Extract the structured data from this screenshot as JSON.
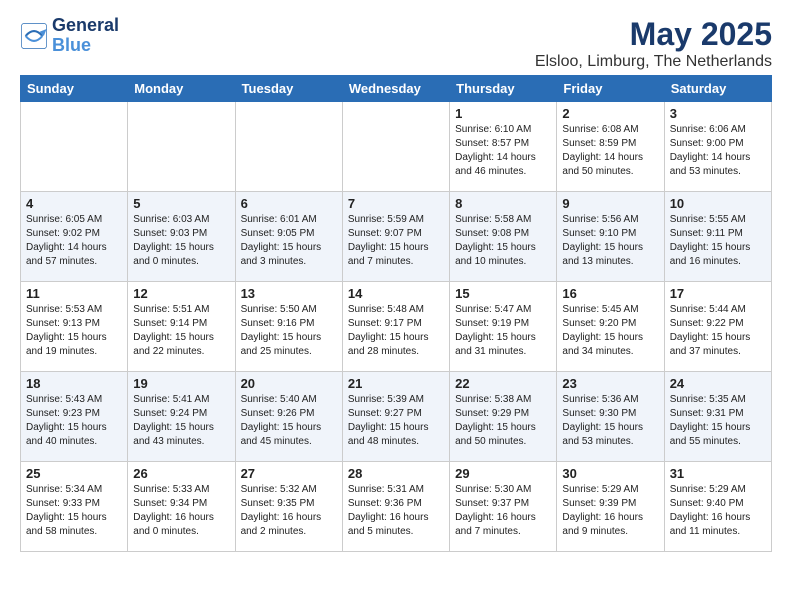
{
  "logo": {
    "line1": "General",
    "line2": "Blue"
  },
  "title": "May 2025",
  "location": "Elsloo, Limburg, The Netherlands",
  "days_of_week": [
    "Sunday",
    "Monday",
    "Tuesday",
    "Wednesday",
    "Thursday",
    "Friday",
    "Saturday"
  ],
  "weeks": [
    [
      {
        "day": "",
        "info": ""
      },
      {
        "day": "",
        "info": ""
      },
      {
        "day": "",
        "info": ""
      },
      {
        "day": "",
        "info": ""
      },
      {
        "day": "1",
        "info": "Sunrise: 6:10 AM\nSunset: 8:57 PM\nDaylight: 14 hours\nand 46 minutes."
      },
      {
        "day": "2",
        "info": "Sunrise: 6:08 AM\nSunset: 8:59 PM\nDaylight: 14 hours\nand 50 minutes."
      },
      {
        "day": "3",
        "info": "Sunrise: 6:06 AM\nSunset: 9:00 PM\nDaylight: 14 hours\nand 53 minutes."
      }
    ],
    [
      {
        "day": "4",
        "info": "Sunrise: 6:05 AM\nSunset: 9:02 PM\nDaylight: 14 hours\nand 57 minutes."
      },
      {
        "day": "5",
        "info": "Sunrise: 6:03 AM\nSunset: 9:03 PM\nDaylight: 15 hours\nand 0 minutes."
      },
      {
        "day": "6",
        "info": "Sunrise: 6:01 AM\nSunset: 9:05 PM\nDaylight: 15 hours\nand 3 minutes."
      },
      {
        "day": "7",
        "info": "Sunrise: 5:59 AM\nSunset: 9:07 PM\nDaylight: 15 hours\nand 7 minutes."
      },
      {
        "day": "8",
        "info": "Sunrise: 5:58 AM\nSunset: 9:08 PM\nDaylight: 15 hours\nand 10 minutes."
      },
      {
        "day": "9",
        "info": "Sunrise: 5:56 AM\nSunset: 9:10 PM\nDaylight: 15 hours\nand 13 minutes."
      },
      {
        "day": "10",
        "info": "Sunrise: 5:55 AM\nSunset: 9:11 PM\nDaylight: 15 hours\nand 16 minutes."
      }
    ],
    [
      {
        "day": "11",
        "info": "Sunrise: 5:53 AM\nSunset: 9:13 PM\nDaylight: 15 hours\nand 19 minutes."
      },
      {
        "day": "12",
        "info": "Sunrise: 5:51 AM\nSunset: 9:14 PM\nDaylight: 15 hours\nand 22 minutes."
      },
      {
        "day": "13",
        "info": "Sunrise: 5:50 AM\nSunset: 9:16 PM\nDaylight: 15 hours\nand 25 minutes."
      },
      {
        "day": "14",
        "info": "Sunrise: 5:48 AM\nSunset: 9:17 PM\nDaylight: 15 hours\nand 28 minutes."
      },
      {
        "day": "15",
        "info": "Sunrise: 5:47 AM\nSunset: 9:19 PM\nDaylight: 15 hours\nand 31 minutes."
      },
      {
        "day": "16",
        "info": "Sunrise: 5:45 AM\nSunset: 9:20 PM\nDaylight: 15 hours\nand 34 minutes."
      },
      {
        "day": "17",
        "info": "Sunrise: 5:44 AM\nSunset: 9:22 PM\nDaylight: 15 hours\nand 37 minutes."
      }
    ],
    [
      {
        "day": "18",
        "info": "Sunrise: 5:43 AM\nSunset: 9:23 PM\nDaylight: 15 hours\nand 40 minutes."
      },
      {
        "day": "19",
        "info": "Sunrise: 5:41 AM\nSunset: 9:24 PM\nDaylight: 15 hours\nand 43 minutes."
      },
      {
        "day": "20",
        "info": "Sunrise: 5:40 AM\nSunset: 9:26 PM\nDaylight: 15 hours\nand 45 minutes."
      },
      {
        "day": "21",
        "info": "Sunrise: 5:39 AM\nSunset: 9:27 PM\nDaylight: 15 hours\nand 48 minutes."
      },
      {
        "day": "22",
        "info": "Sunrise: 5:38 AM\nSunset: 9:29 PM\nDaylight: 15 hours\nand 50 minutes."
      },
      {
        "day": "23",
        "info": "Sunrise: 5:36 AM\nSunset: 9:30 PM\nDaylight: 15 hours\nand 53 minutes."
      },
      {
        "day": "24",
        "info": "Sunrise: 5:35 AM\nSunset: 9:31 PM\nDaylight: 15 hours\nand 55 minutes."
      }
    ],
    [
      {
        "day": "25",
        "info": "Sunrise: 5:34 AM\nSunset: 9:33 PM\nDaylight: 15 hours\nand 58 minutes."
      },
      {
        "day": "26",
        "info": "Sunrise: 5:33 AM\nSunset: 9:34 PM\nDaylight: 16 hours\nand 0 minutes."
      },
      {
        "day": "27",
        "info": "Sunrise: 5:32 AM\nSunset: 9:35 PM\nDaylight: 16 hours\nand 2 minutes."
      },
      {
        "day": "28",
        "info": "Sunrise: 5:31 AM\nSunset: 9:36 PM\nDaylight: 16 hours\nand 5 minutes."
      },
      {
        "day": "29",
        "info": "Sunrise: 5:30 AM\nSunset: 9:37 PM\nDaylight: 16 hours\nand 7 minutes."
      },
      {
        "day": "30",
        "info": "Sunrise: 5:29 AM\nSunset: 9:39 PM\nDaylight: 16 hours\nand 9 minutes."
      },
      {
        "day": "31",
        "info": "Sunrise: 5:29 AM\nSunset: 9:40 PM\nDaylight: 16 hours\nand 11 minutes."
      }
    ]
  ]
}
